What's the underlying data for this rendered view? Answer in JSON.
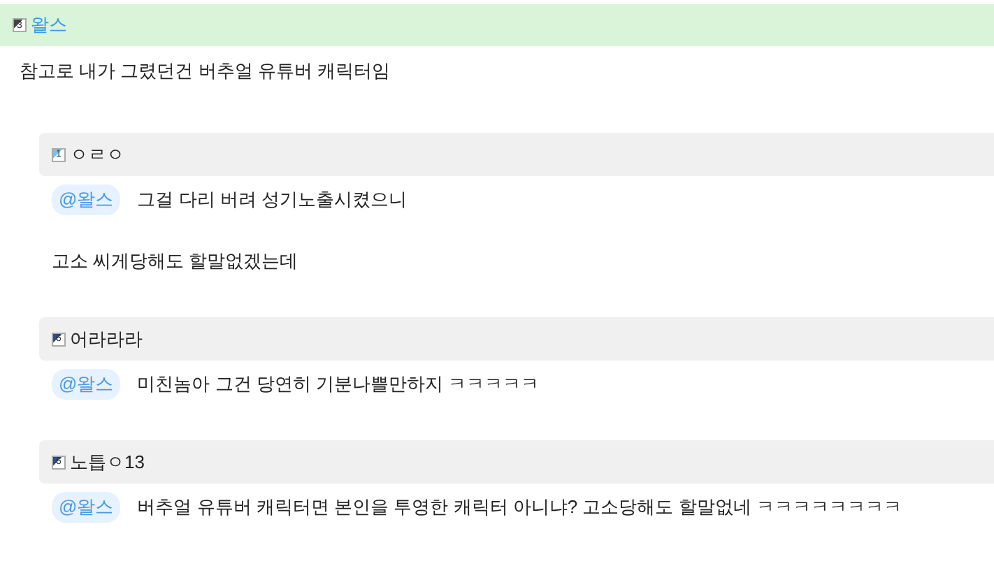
{
  "post": {
    "author": {
      "level": "3",
      "color": "#444444",
      "name": "왈스"
    },
    "body": "참고로 내가 그렸던건 버추얼 유튜버 캐릭터임"
  },
  "replies": [
    {
      "author": {
        "level": "1",
        "color": "#6ec6f0",
        "name": "ㅇㄹㅇ"
      },
      "mention": "@왈스",
      "paragraphs": [
        "그걸 다리 버려 성기노출시켰으니",
        "고소 씨게당해도 할말없겠는데"
      ]
    },
    {
      "author": {
        "level": "6",
        "color": "#2b4f8a",
        "name": "어라라라"
      },
      "mention": "@왈스",
      "paragraphs": [
        "미친놈아 그건 당연히 기분나쁠만하지 ㅋㅋㅋㅋㅋ"
      ]
    },
    {
      "author": {
        "level": "6",
        "color": "#2b4f8a",
        "name": "노틉ㅇ13"
      },
      "mention": "@왈스",
      "paragraphs": [
        "버추얼 유튜버 캐릭터면 본인을 투영한 캐릭터 아니냐? 고소당해도 할말없네 ㅋㅋㅋㅋㅋㅋㅋㅋ"
      ]
    }
  ]
}
